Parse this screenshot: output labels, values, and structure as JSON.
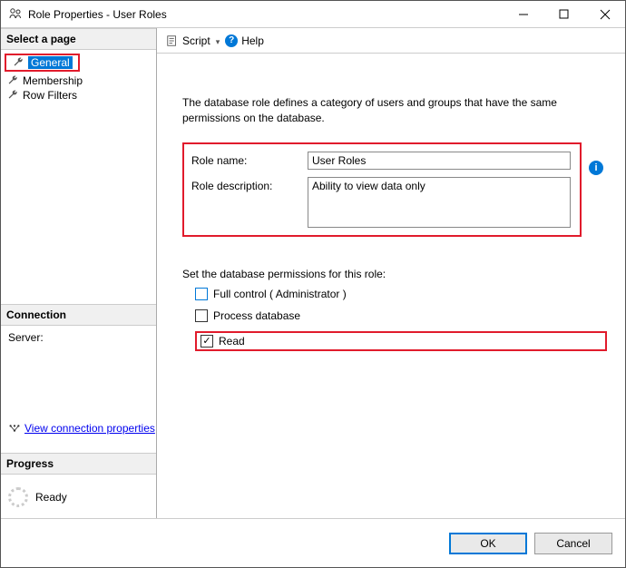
{
  "window": {
    "title": "Role Properties - User Roles"
  },
  "sidebar": {
    "select_header": "Select a page",
    "items": [
      {
        "label": "General",
        "selected": true
      },
      {
        "label": "Membership",
        "selected": false
      },
      {
        "label": "Row Filters",
        "selected": false
      }
    ],
    "connection_header": "Connection",
    "server_label": "Server:",
    "view_connection_link": "View connection properties",
    "progress_header": "Progress",
    "progress_status": "Ready"
  },
  "toolbar": {
    "script_label": "Script",
    "help_label": "Help"
  },
  "form": {
    "intro": "The database role defines a category of users and groups that have the same permissions on the database.",
    "role_name_label": "Role name:",
    "role_name_value": "User Roles",
    "role_desc_label": "Role description:",
    "role_desc_value": "Ability to view data only",
    "permissions_label": "Set the database permissions for this role:",
    "perm_full": "Full control ( Administrator )",
    "perm_process": "Process database",
    "perm_read": "Read",
    "perm_full_checked": false,
    "perm_process_checked": false,
    "perm_read_checked": true
  },
  "buttons": {
    "ok": "OK",
    "cancel": "Cancel"
  }
}
